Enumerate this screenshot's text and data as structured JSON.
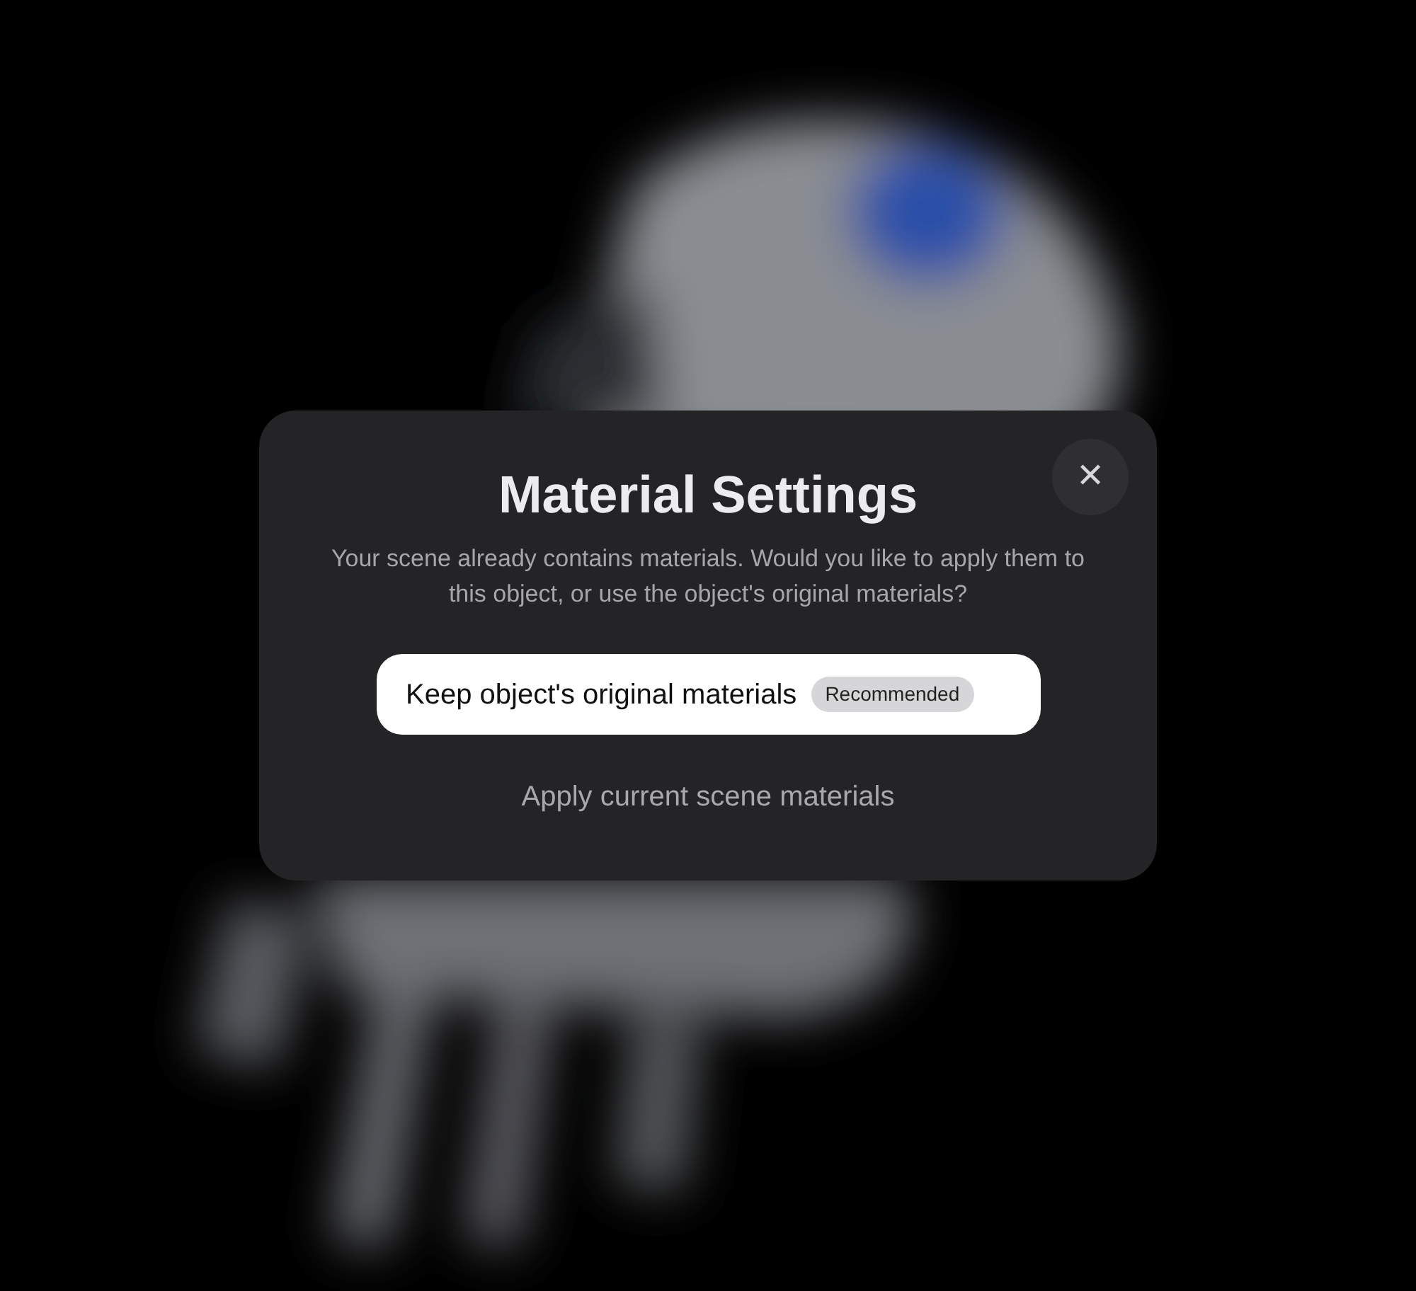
{
  "dialog": {
    "title": "Material Settings",
    "message": "Your scene already contains materials. Would you like to apply them to this object, or use the object's original materials?",
    "options": [
      {
        "kind": "primary",
        "label": "Keep object's original materials",
        "badge": "Recommended"
      },
      {
        "kind": "link",
        "label": "Apply current scene materials"
      }
    ],
    "close_glyph": "✕"
  }
}
